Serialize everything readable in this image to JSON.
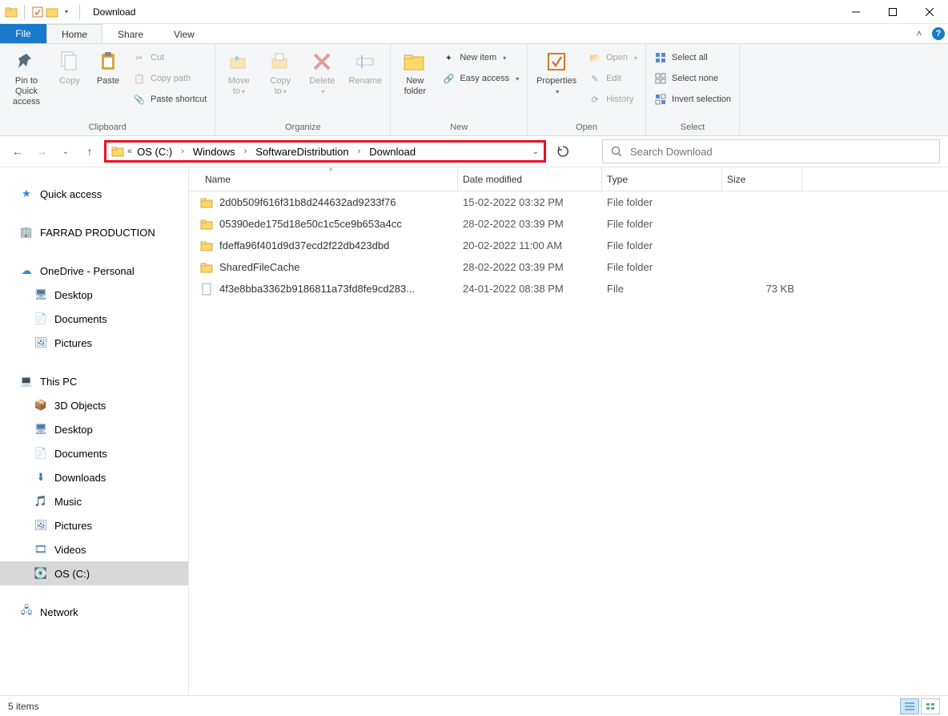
{
  "window": {
    "title": "Download"
  },
  "tabs": {
    "file": "File",
    "home": "Home",
    "share": "Share",
    "view": "View"
  },
  "ribbon": {
    "clipboard": {
      "label": "Clipboard",
      "pin": "Pin to Quick\naccess",
      "copy": "Copy",
      "paste": "Paste",
      "cut": "Cut",
      "copy_path": "Copy path",
      "paste_shortcut": "Paste shortcut"
    },
    "organize": {
      "label": "Organize",
      "move_to": "Move\nto",
      "copy_to": "Copy\nto",
      "delete": "Delete",
      "rename": "Rename"
    },
    "new": {
      "label": "New",
      "new_folder": "New\nfolder",
      "new_item": "New item",
      "easy_access": "Easy access"
    },
    "open": {
      "label": "Open",
      "properties": "Properties",
      "open": "Open",
      "edit": "Edit",
      "history": "History"
    },
    "select": {
      "label": "Select",
      "select_all": "Select all",
      "select_none": "Select none",
      "invert": "Invert selection"
    }
  },
  "breadcrumb": [
    "OS (C:)",
    "Windows",
    "SoftwareDistribution",
    "Download"
  ],
  "search": {
    "placeholder": "Search Download"
  },
  "columns": {
    "name": "Name",
    "date": "Date modified",
    "type": "Type",
    "size": "Size"
  },
  "files": [
    {
      "icon": "folder",
      "name": "2d0b509f616f31b8d244632ad9233f76",
      "date": "15-02-2022 03:32 PM",
      "type": "File folder",
      "size": ""
    },
    {
      "icon": "folder",
      "name": "05390ede175d18e50c1c5ce9b653a4cc",
      "date": "28-02-2022 03:39 PM",
      "type": "File folder",
      "size": ""
    },
    {
      "icon": "folder",
      "name": "fdeffa96f401d9d37ecd2f22db423dbd",
      "date": "20-02-2022 11:00 AM",
      "type": "File folder",
      "size": ""
    },
    {
      "icon": "folder",
      "name": "SharedFileCache",
      "date": "28-02-2022 03:39 PM",
      "type": "File folder",
      "size": ""
    },
    {
      "icon": "file",
      "name": "4f3e8bba3362b9186811a73fd8fe9cd283...",
      "date": "24-01-2022 08:38 PM",
      "type": "File",
      "size": "73 KB"
    }
  ],
  "sidebar": {
    "quick_access": "Quick access",
    "farrad": "FARRAD PRODUCTION",
    "onedrive": "OneDrive - Personal",
    "onedrive_items": [
      "Desktop",
      "Documents",
      "Pictures"
    ],
    "this_pc": "This PC",
    "this_pc_items": [
      "3D Objects",
      "Desktop",
      "Documents",
      "Downloads",
      "Music",
      "Pictures",
      "Videos",
      "OS (C:)"
    ],
    "network": "Network"
  },
  "status": {
    "count": "5 items"
  }
}
